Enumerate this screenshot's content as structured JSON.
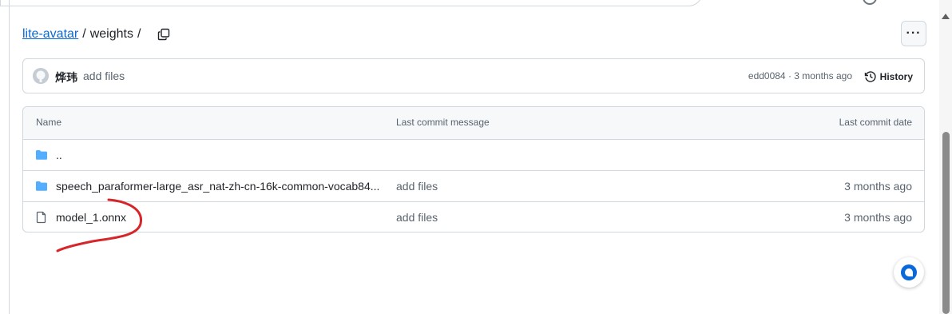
{
  "breadcrumb": {
    "repo_link": "lite-avatar",
    "separator": "/",
    "current": "weights",
    "trailing_separator": "/"
  },
  "more_button": {
    "label": "···",
    "icon": "kebab-horizontal-icon"
  },
  "latest_commit": {
    "author": "烨玮",
    "message": "add files",
    "meta": "edd0084 · 3 months ago",
    "history_label": "History"
  },
  "file_table": {
    "headers": {
      "name": "Name",
      "message": "Last commit message",
      "date": "Last commit date"
    },
    "rows": [
      {
        "type": "folder",
        "name": "..",
        "message": "",
        "date": ""
      },
      {
        "type": "folder",
        "name": "speech_paraformer-large_asr_nat-zh-cn-16k-common-vocab84...",
        "message": "add files",
        "date": "3 months ago"
      },
      {
        "type": "file",
        "name": "model_1.onnx",
        "message": "add files",
        "date": "3 months ago"
      }
    ]
  },
  "colors": {
    "link": "#0969da",
    "folder": "#54aeff",
    "annotation": "#d7262a",
    "copilot": "#0969da"
  }
}
